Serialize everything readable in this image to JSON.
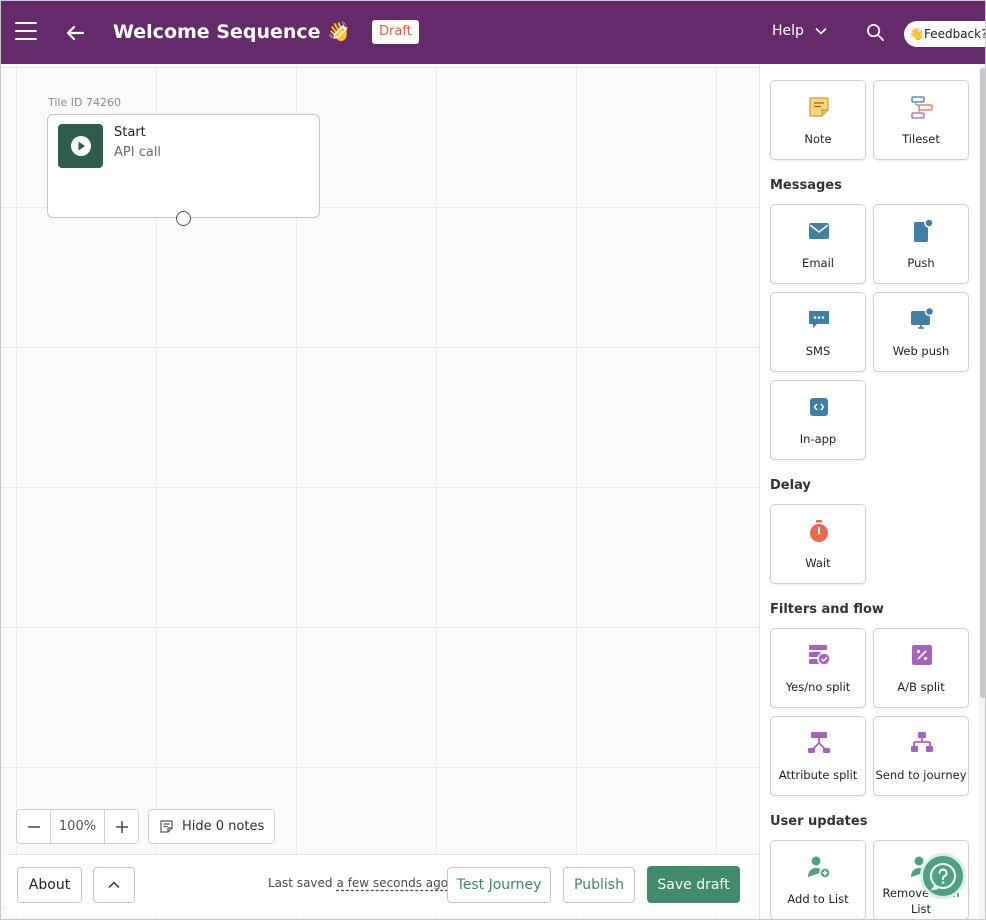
{
  "header": {
    "title": "Welcome Sequence 👋",
    "status_badge": "Draft",
    "help_label": "Help",
    "feedback_label": "👋Feedback?",
    "bg_color": "#642a6a"
  },
  "canvas": {
    "start_tile": {
      "tile_id": "Tile ID 74260",
      "title": "Start",
      "subtitle": "API call"
    },
    "zoom_level": "100%",
    "hide_notes_label": "Hide 0 notes"
  },
  "footer": {
    "about_label": "About",
    "last_saved_label": "Last saved",
    "last_saved_time": "a few seconds ago",
    "test_journey_label": "Test Journey",
    "publish_label": "Publish",
    "save_draft_label": "Save draft"
  },
  "sidebar": {
    "tools": [
      {
        "label": "Note",
        "icon": "note-icon"
      },
      {
        "label": "Tileset",
        "icon": "tileset-icon"
      }
    ],
    "messages": {
      "title": "Messages",
      "items": [
        {
          "label": "Email",
          "icon": "email-icon"
        },
        {
          "label": "Push",
          "icon": "push-icon"
        },
        {
          "label": "SMS",
          "icon": "sms-icon"
        },
        {
          "label": "Web push",
          "icon": "web-push-icon"
        },
        {
          "label": "In-app",
          "icon": "in-app-icon"
        }
      ]
    },
    "delay": {
      "title": "Delay",
      "items": [
        {
          "label": "Wait",
          "icon": "stopwatch-icon"
        }
      ]
    },
    "filters": {
      "title": "Filters and flow",
      "items": [
        {
          "label": "Yes/no split",
          "icon": "yes-no-split-icon"
        },
        {
          "label": "A/B split",
          "icon": "ab-split-icon"
        },
        {
          "label": "Attribute split",
          "icon": "attribute-split-icon"
        },
        {
          "label": "Send to journey",
          "icon": "send-to-journey-icon"
        }
      ]
    },
    "user_updates": {
      "title": "User updates",
      "items": [
        {
          "label": "Add to List",
          "icon": "add-to-list-icon"
        },
        {
          "label": "Remove from List",
          "icon": "remove-from-list-icon"
        }
      ]
    }
  },
  "colors": {
    "brand_purple": "#642a6a",
    "accent_green": "#3f8b6b",
    "message_blue": "#3f7fa3",
    "filter_purple": "#a762bf",
    "delay_orange": "#e9694a"
  }
}
